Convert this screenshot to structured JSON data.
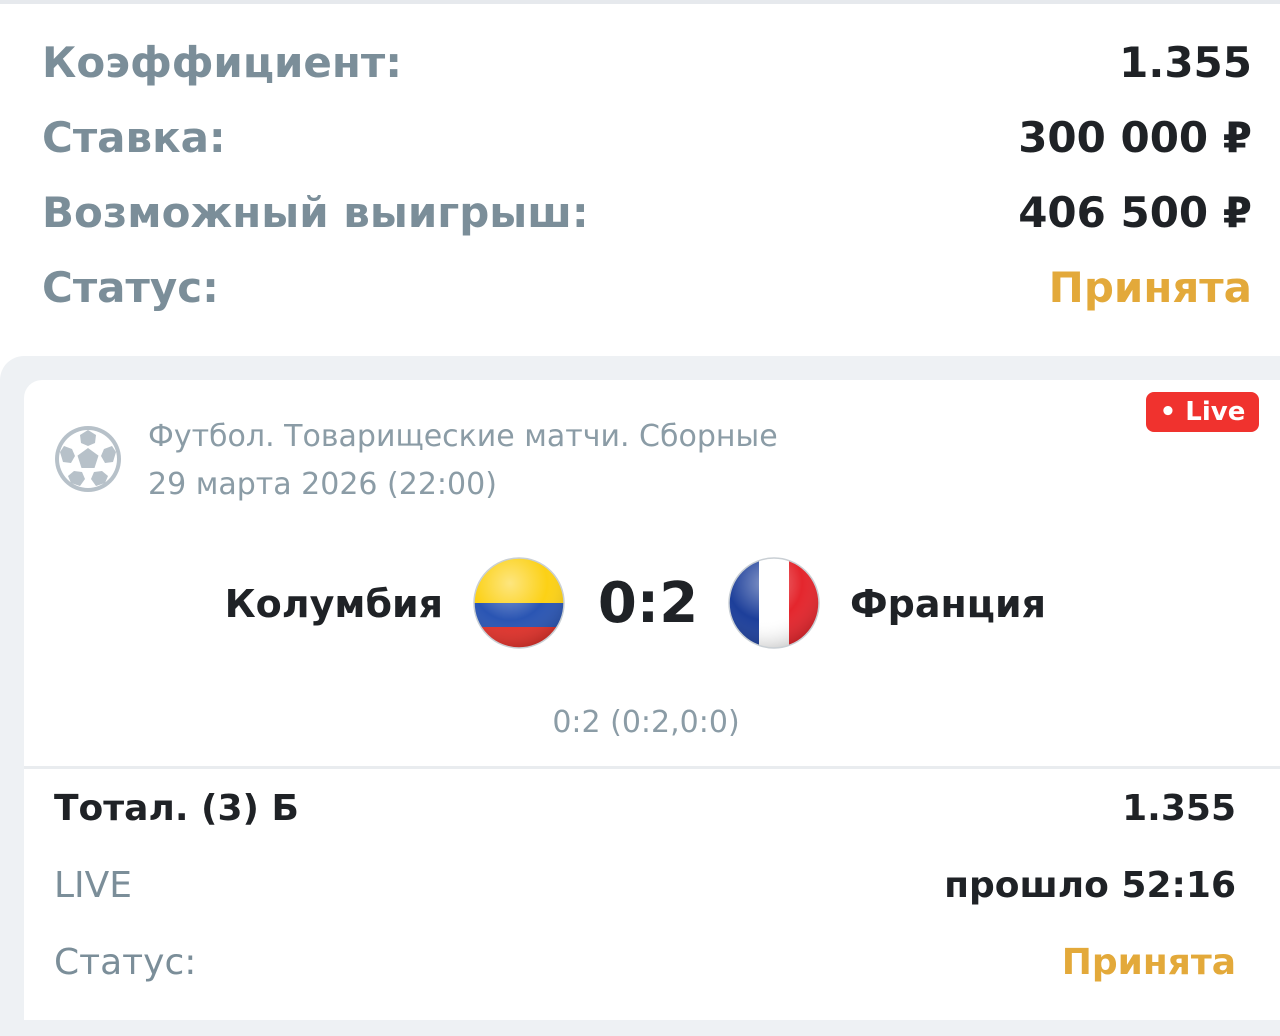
{
  "summary": {
    "coefficient_label": "Коэффициент:",
    "coefficient_value": "1.355",
    "stake_label": "Ставка:",
    "stake_value": "300 000 ₽",
    "payout_label": "Возможный выигрыш:",
    "payout_value": "406 500 ₽",
    "status_label": "Статус:",
    "status_value": "Принята"
  },
  "match": {
    "live_badge": "• Live",
    "league": "Футбол. Товарищеские матчи. Сборные",
    "date": "29 марта 2026 (22:00)",
    "home_team": "Колумбия",
    "away_team": "Франция",
    "score": "0:2",
    "period_scores": "0:2 (0:2,0:0)",
    "home_flag": "colombia-flag-icon",
    "away_flag": "france-flag-icon",
    "sport_icon": "soccer-ball-icon"
  },
  "bet": {
    "market": "Тотал. (3) Б",
    "odds": "1.355",
    "mode_label": "LIVE",
    "elapsed": "прошло 52:16",
    "status_label": "Статус:",
    "status_value": "Принята"
  },
  "colors": {
    "accepted": "#e3a93a",
    "live_badge": "#f0322e",
    "muted_text": "#7b8e99",
    "dark_text": "#1f2226",
    "card_background": "#eef1f4"
  }
}
